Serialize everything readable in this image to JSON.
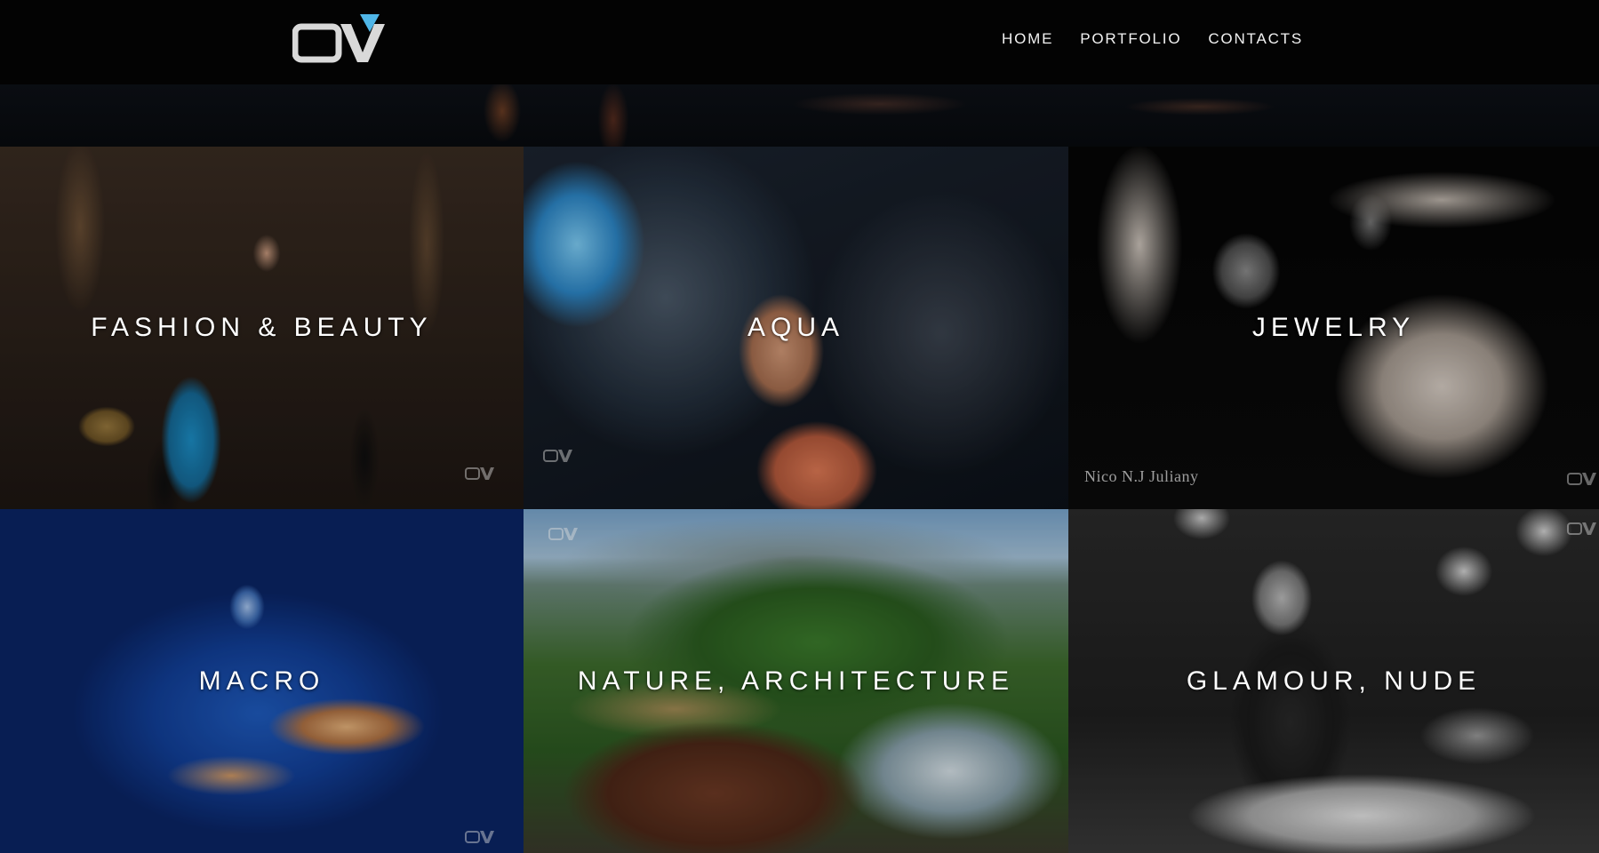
{
  "header": {
    "nav": [
      {
        "label": "HOME"
      },
      {
        "label": "PORTFOLIO"
      },
      {
        "label": "CONTACTS"
      }
    ]
  },
  "gallery": {
    "tiles": [
      {
        "label": "FASHION & BEAUTY"
      },
      {
        "label": "AQUA"
      },
      {
        "label": "JEWELRY",
        "signature": "Nico N.J Juliany"
      },
      {
        "label": "MACRO"
      },
      {
        "label": "NATURE, ARCHITECTURE"
      },
      {
        "label": "GLAMOUR, NUDE"
      }
    ]
  },
  "colors": {
    "accent": "#4fb6e8",
    "logo_gray": "#d9d9d9",
    "header_bg": "#030303",
    "label_text": "#ffffff"
  }
}
